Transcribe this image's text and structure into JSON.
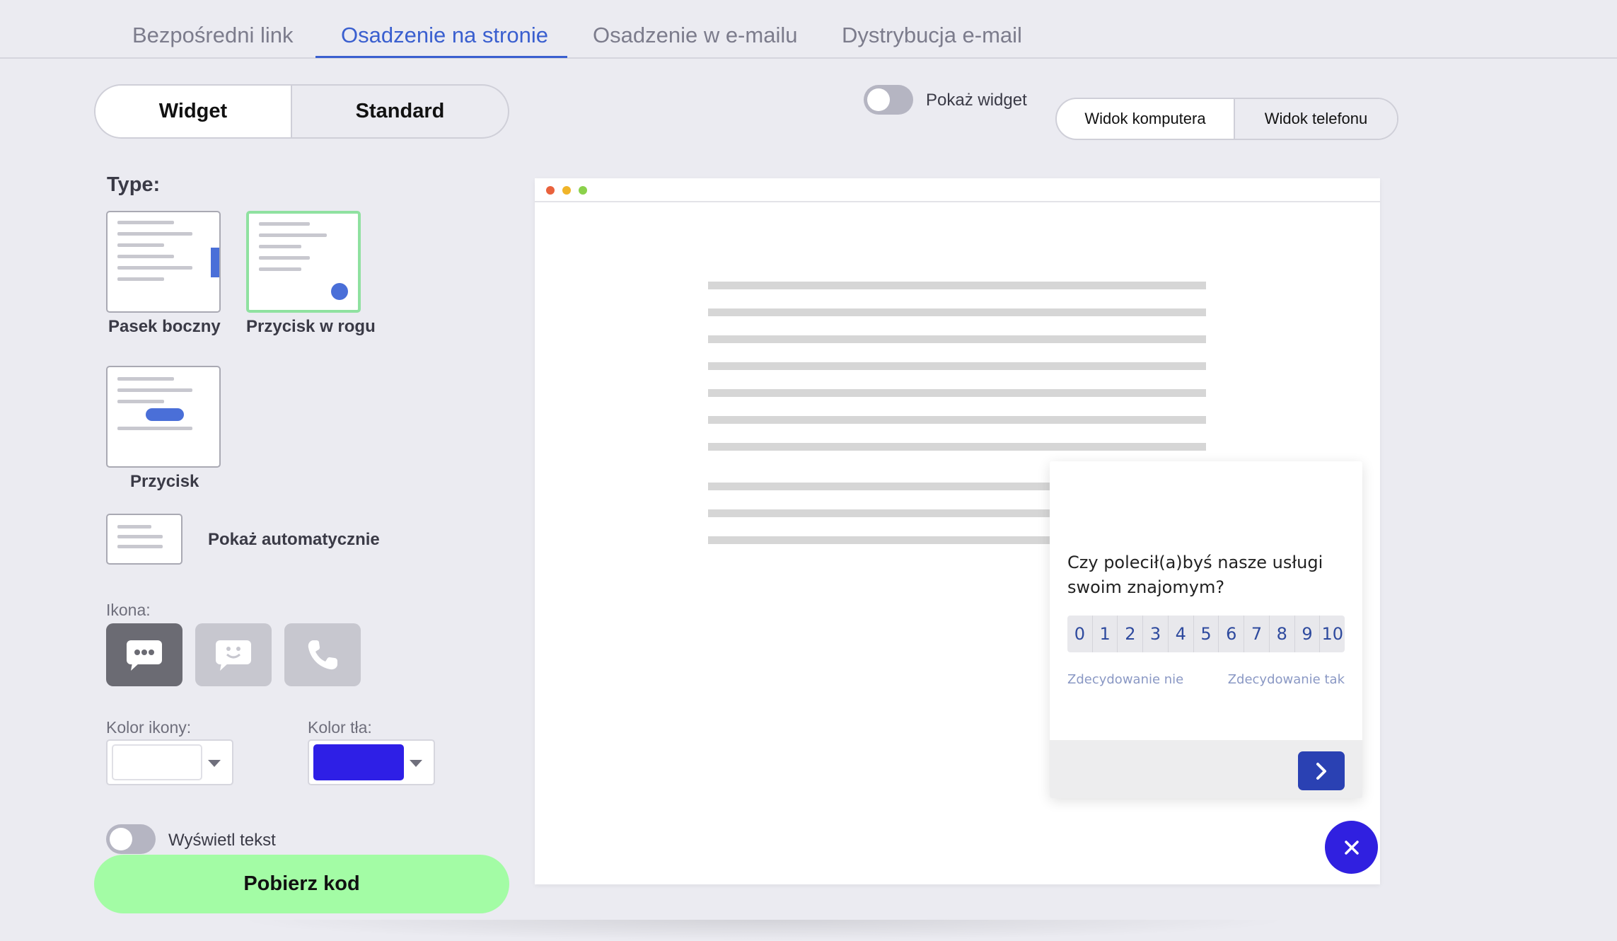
{
  "tabs": [
    {
      "label": "Bezpośredni link"
    },
    {
      "label": "Osadzenie na stronie"
    },
    {
      "label": "Osadzenie w e-mailu"
    },
    {
      "label": "Dystrybucja e-mail"
    }
  ],
  "active_tab": "Osadzenie na stronie",
  "mode_toggle": {
    "widget": "Widget",
    "standard": "Standard",
    "selected": "Widget"
  },
  "type_section": {
    "label": "Type:",
    "options": [
      {
        "label": "Pasek boczny"
      },
      {
        "label": "Przycisk w rogu"
      },
      {
        "label": "Przycisk"
      },
      {
        "label": "Pokaż automatycznie"
      }
    ],
    "selected": "Przycisk w rogu"
  },
  "icon_section": {
    "label": "Ikona:",
    "icons": [
      "chat-dots-icon",
      "chat-smile-icon",
      "phone-icon"
    ],
    "selected": "chat-dots-icon"
  },
  "icon_color": {
    "label": "Kolor ikony:",
    "value": "#ffffff"
  },
  "bg_color": {
    "label": "Kolor tła:",
    "value": "#2e1fe6"
  },
  "show_text": {
    "label": "Wyświetl tekst",
    "on": false
  },
  "download": {
    "label": "Pobierz kod"
  },
  "show_widget": {
    "label": "Pokaż widget",
    "on": false
  },
  "view_toggle": {
    "desktop": "Widok komputera",
    "phone": "Widok telefonu",
    "selected": "Widok komputera"
  },
  "survey": {
    "question": "Czy polecił(a)byś nasze usługi swoim znajomym?",
    "scale": [
      "0",
      "1",
      "2",
      "3",
      "4",
      "5",
      "6",
      "7",
      "8",
      "9",
      "10"
    ],
    "low_label": "Zdecydowanie nie",
    "high_label": "Zdecydowanie tak"
  },
  "colors": {
    "accent": "#3a5fcf",
    "selected_border": "#8fe1a0",
    "download_bg": "#a3fca5",
    "fab": "#3020e0",
    "next": "#2a41b3"
  }
}
